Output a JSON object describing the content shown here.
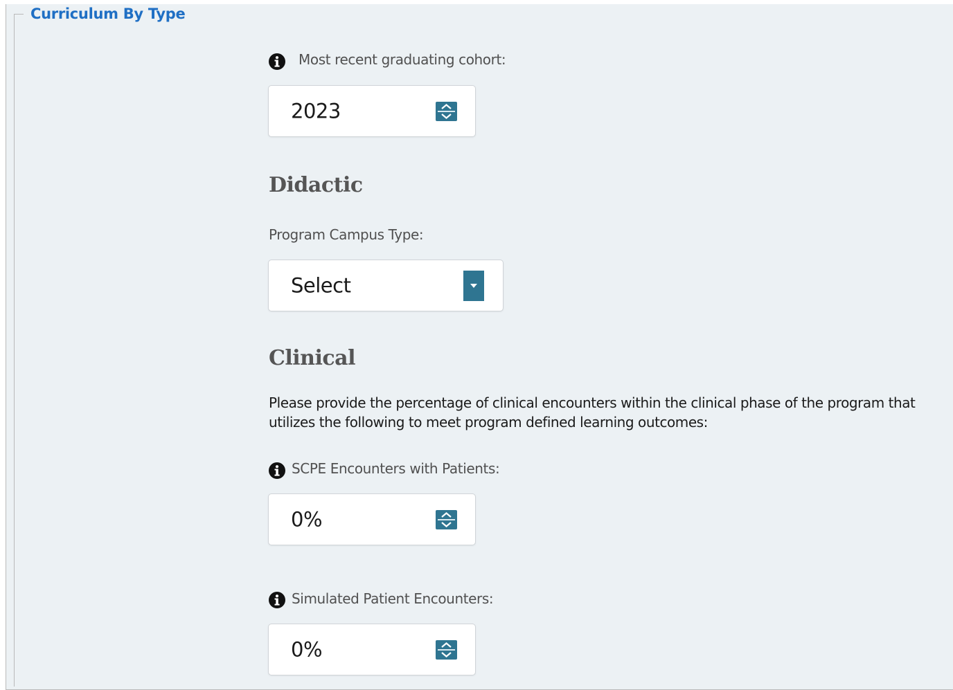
{
  "fieldset": {
    "legend": "Curriculum By Type"
  },
  "cohort": {
    "label": "Most recent graduating cohort:",
    "value": "2023"
  },
  "didactic": {
    "heading": "Didactic",
    "campus_type_label": "Program Campus Type:",
    "campus_type_value": "Select"
  },
  "clinical": {
    "heading": "Clinical",
    "instructions": "Please provide the percentage of clinical encounters within the clinical phase of the program that utilizes the following to meet program defined learning outcomes:",
    "scpe": {
      "label": "SCPE Encounters with Patients:",
      "value": "0%"
    },
    "simulated": {
      "label": "Simulated Patient Encounters:",
      "value": "0%"
    }
  },
  "colors": {
    "accent": "#2f7591",
    "legend": "#1f6fc4",
    "panel_bg": "#ecf1f4"
  },
  "icons": {
    "info": "info-icon",
    "spinner": "spinner-up-down-icon",
    "dropdown": "dropdown-arrow-icon"
  }
}
